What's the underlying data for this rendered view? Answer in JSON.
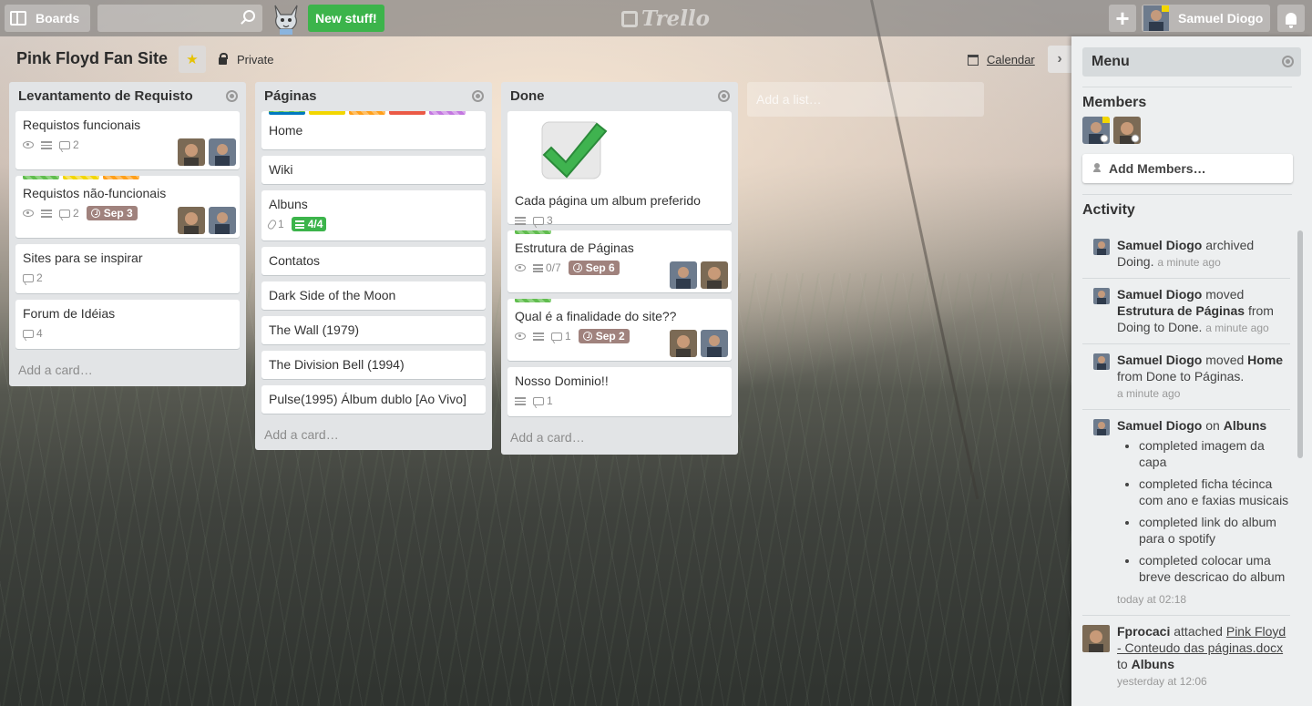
{
  "header": {
    "boards_label": "Boards",
    "search_placeholder": "",
    "new_stuff_label": "New stuff!",
    "logo_text": "Trello",
    "user_name": "Samuel Diogo"
  },
  "board": {
    "title": "Pink Floyd Fan Site",
    "visibility": "Private",
    "calendar_label": "Calendar"
  },
  "lists": [
    {
      "name": "Levantamento de Requisto",
      "cards": [
        {
          "title": "Requistos funcionais",
          "comments": "2"
        },
        {
          "title": "Requistos não-funcionais",
          "comments": "2",
          "due": "Sep 3"
        },
        {
          "title": "Sites para se inspirar",
          "comments": "2"
        },
        {
          "title": "Forum de Idéias",
          "comments": "4"
        }
      ],
      "add_card": "Add a card…"
    },
    {
      "name": "Páginas",
      "cards": [
        {
          "title": "Home"
        },
        {
          "title": "Wiki"
        },
        {
          "title": "Albuns",
          "attachments": "1",
          "checklist": "4/4"
        },
        {
          "title": "Contatos"
        },
        {
          "title": "Dark Side of the Moon"
        },
        {
          "title": "The Wall (1979)"
        },
        {
          "title": "The Division Bell (1994)"
        },
        {
          "title": "Pulse(1995) Álbum dublo [Ao Vivo]"
        }
      ],
      "add_card": "Add a card…"
    },
    {
      "name": "Done",
      "cards": [
        {
          "title": "Cada página um album preferido",
          "comments": "3"
        },
        {
          "title": "Estrutura de Páginas",
          "checklist": "0/7",
          "due": "Sep 6"
        },
        {
          "title": "Qual é a finalidade do site??",
          "comments": "1",
          "due": "Sep 2"
        },
        {
          "title": "Nosso Dominio!!",
          "comments": "1"
        }
      ],
      "add_card": "Add a card…"
    }
  ],
  "add_list": "Add a list…",
  "sidebar": {
    "menu_title": "Menu",
    "members_title": "Members",
    "add_members": "Add Members…",
    "activity_title": "Activity",
    "activity": [
      {
        "user": "Samuel Diogo",
        "text": "archived",
        "target": "Doing.",
        "time": "a minute ago"
      },
      {
        "user": "Samuel Diogo",
        "text": "moved",
        "card": "Estrutura de Páginas",
        "from": "from",
        "rest": "Doing to Done.",
        "time": "a minute ago"
      },
      {
        "user": "Samuel Diogo",
        "text": "moved",
        "card": "Home",
        "rest": "from Done to Páginas.",
        "time": "a minute ago"
      },
      {
        "user": "Samuel Diogo",
        "text": "on",
        "card": "Albuns",
        "items": [
          "completed imagem da capa",
          "completed ficha técinca com ano e faxias musicais",
          "completed link do album para o spotify",
          "completed colocar uma breve descricao do album"
        ],
        "time": "today at 02:18"
      },
      {
        "user": "Fprocaci",
        "text": "attached",
        "link": "Pink Floyd - Conteudo das páginas.docx",
        "to": "to",
        "card": "Albuns",
        "time": "yesterday at 12:06"
      }
    ]
  },
  "colors": {
    "label_green": "#61bd4f",
    "label_yellow": "#f2d600",
    "label_orange": "#ff9f1a",
    "label_red": "#eb5a46",
    "label_purple": "#c377e0",
    "label_blue": "#0079bf",
    "due_badge": "#a0827d",
    "checklist_complete": "#3cb44b",
    "new_stuff": "#3cb44b"
  }
}
